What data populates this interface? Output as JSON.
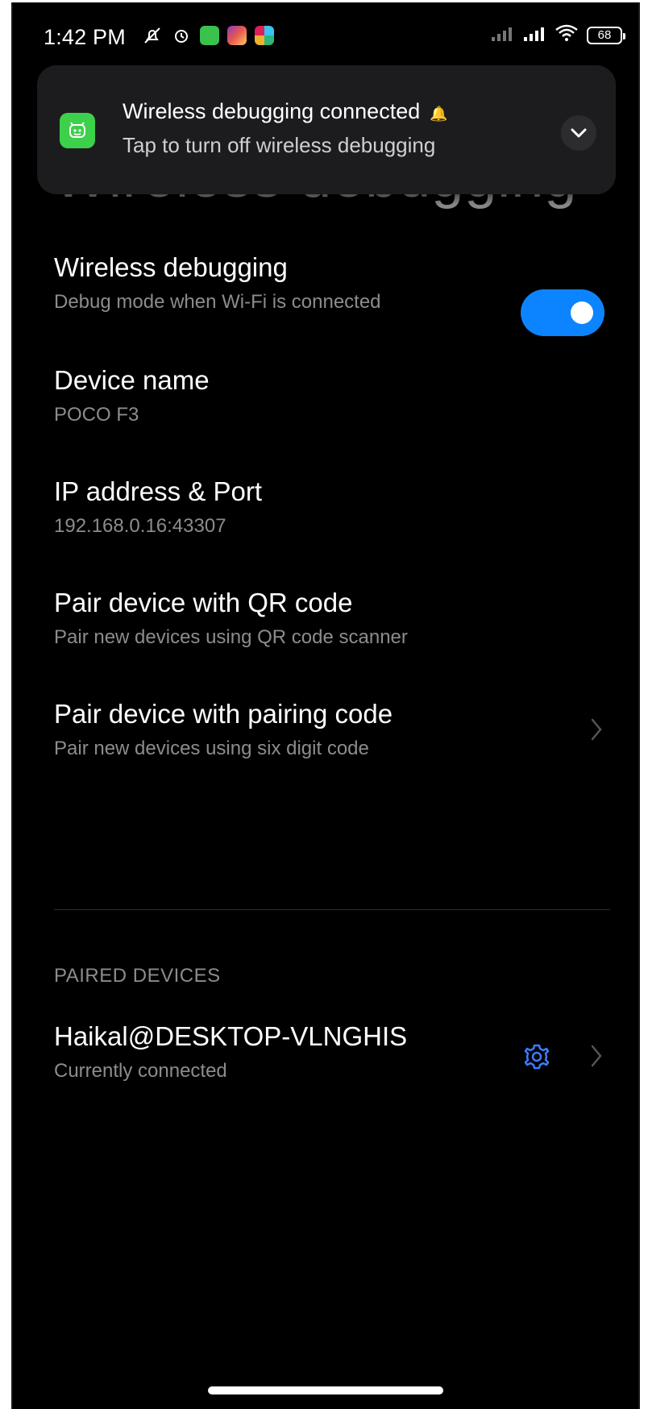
{
  "status_bar": {
    "time": "1:42 PM",
    "battery": "68",
    "left_icons": [
      "mute-icon",
      "alarm-icon",
      "green-app-icon",
      "instagram-icon",
      "slack-icon"
    ],
    "right_icons": [
      "signal-icon",
      "signal-icon-2",
      "wifi-icon",
      "battery-icon"
    ]
  },
  "page": {
    "title": "Wireless debugging"
  },
  "notification": {
    "title": "Wireless debugging connected",
    "body": "Tap to turn off wireless debugging",
    "app_icon_color": "#3dd04a"
  },
  "settings": {
    "wireless_debugging": {
      "title": "Wireless debugging",
      "subtitle": "Debug mode when Wi-Fi is connected",
      "enabled": true
    },
    "device_name": {
      "title": "Device name",
      "value": "POCO F3"
    },
    "ip_address": {
      "title": "IP address & Port",
      "value": "192.168.0.16:43307"
    },
    "pair_qr": {
      "title": "Pair device with QR code",
      "subtitle": "Pair new devices using QR code scanner"
    },
    "pair_code": {
      "title": "Pair device with pairing code",
      "subtitle": "Pair new devices using six digit code"
    }
  },
  "paired_devices": {
    "header": "PAIRED DEVICES",
    "items": [
      {
        "name": "Haikal@DESKTOP-VLNGHIS",
        "status": "Currently connected"
      }
    ]
  },
  "colors": {
    "accent": "#0d84ff",
    "background": "#000000",
    "secondary_text": "#8c8c8c"
  }
}
